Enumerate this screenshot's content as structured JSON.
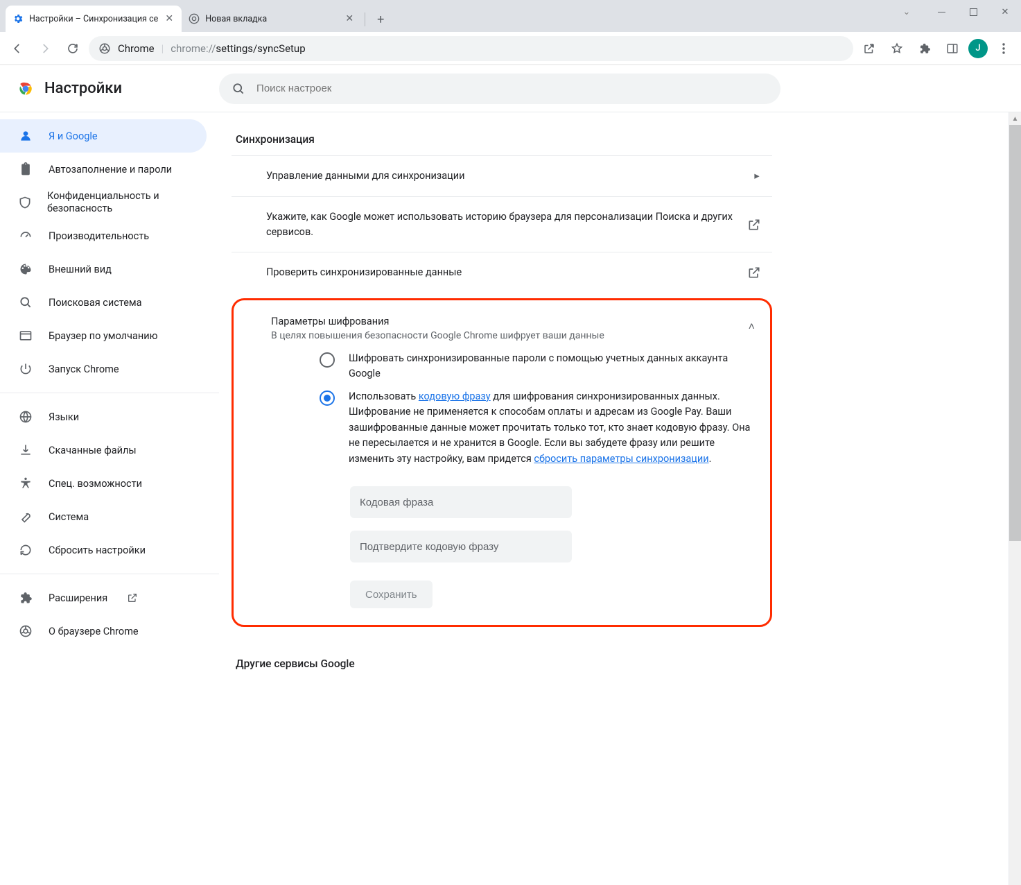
{
  "titlebar": {
    "tabs": [
      {
        "title": "Настройки – Синхронизация се",
        "active": true
      },
      {
        "title": "Новая вкладка",
        "active": false
      }
    ]
  },
  "omnibox": {
    "label": "Chrome",
    "url_prefix": "chrome://",
    "url_path": "settings/syncSetup"
  },
  "avatar": {
    "letter": "J"
  },
  "page": {
    "title": "Настройки",
    "search_placeholder": "Поиск настроек"
  },
  "sidebar": {
    "items": [
      {
        "label": "Я и Google",
        "icon": "person",
        "active": true
      },
      {
        "label": "Автозаполнение и пароли",
        "icon": "clipboard"
      },
      {
        "label": "Конфиденциальность и безопасность",
        "icon": "shield"
      },
      {
        "label": "Производительность",
        "icon": "speed"
      },
      {
        "label": "Внешний вид",
        "icon": "palette"
      },
      {
        "label": "Поисковая система",
        "icon": "search"
      },
      {
        "label": "Браузер по умолчанию",
        "icon": "browser"
      },
      {
        "label": "Запуск Chrome",
        "icon": "power"
      }
    ],
    "items2": [
      {
        "label": "Языки",
        "icon": "globe"
      },
      {
        "label": "Скачанные файлы",
        "icon": "download"
      },
      {
        "label": "Спец. возможности",
        "icon": "access"
      },
      {
        "label": "Система",
        "icon": "wrench"
      },
      {
        "label": "Сбросить настройки",
        "icon": "reset"
      }
    ],
    "items3": [
      {
        "label": "Расширения",
        "icon": "puzzle",
        "external": true
      },
      {
        "label": "О браузере Chrome",
        "icon": "chrome"
      }
    ]
  },
  "main": {
    "section_title": "Синхронизация",
    "rows": {
      "manage": "Управление данными для синхронизации",
      "personalize": "Укажите, как Google может использовать историю браузера для персонализации Поиска и других сервисов.",
      "check": "Проверить синхронизированные данные"
    },
    "enc": {
      "title": "Параметры шифрования",
      "sub": "В целях повышения безопасности Google Chrome шифрует ваши данные",
      "opt1": "Шифровать синхронизированные пароли с помощью учетных данных аккаунта Google",
      "opt2_a": "Использовать ",
      "opt2_link1": "кодовую фразу",
      "opt2_b": " для шифрования синхронизированных данных. Шифрование не применяется к способам оплаты и адресам из Google Pay. Ваши зашифрованные данные может прочитать только тот, кто знает кодовую фразу. Она не пересылается и не хранится в Google. Если вы забудете фразу или решите изменить эту настройку, вам придется ",
      "opt2_link2": "сбросить параметры синхронизации",
      "opt2_c": ".",
      "ph1": "Кодовая фраза",
      "ph2": "Подтвердите кодовую фразу",
      "save": "Сохранить"
    },
    "section2": "Другие сервисы Google"
  }
}
